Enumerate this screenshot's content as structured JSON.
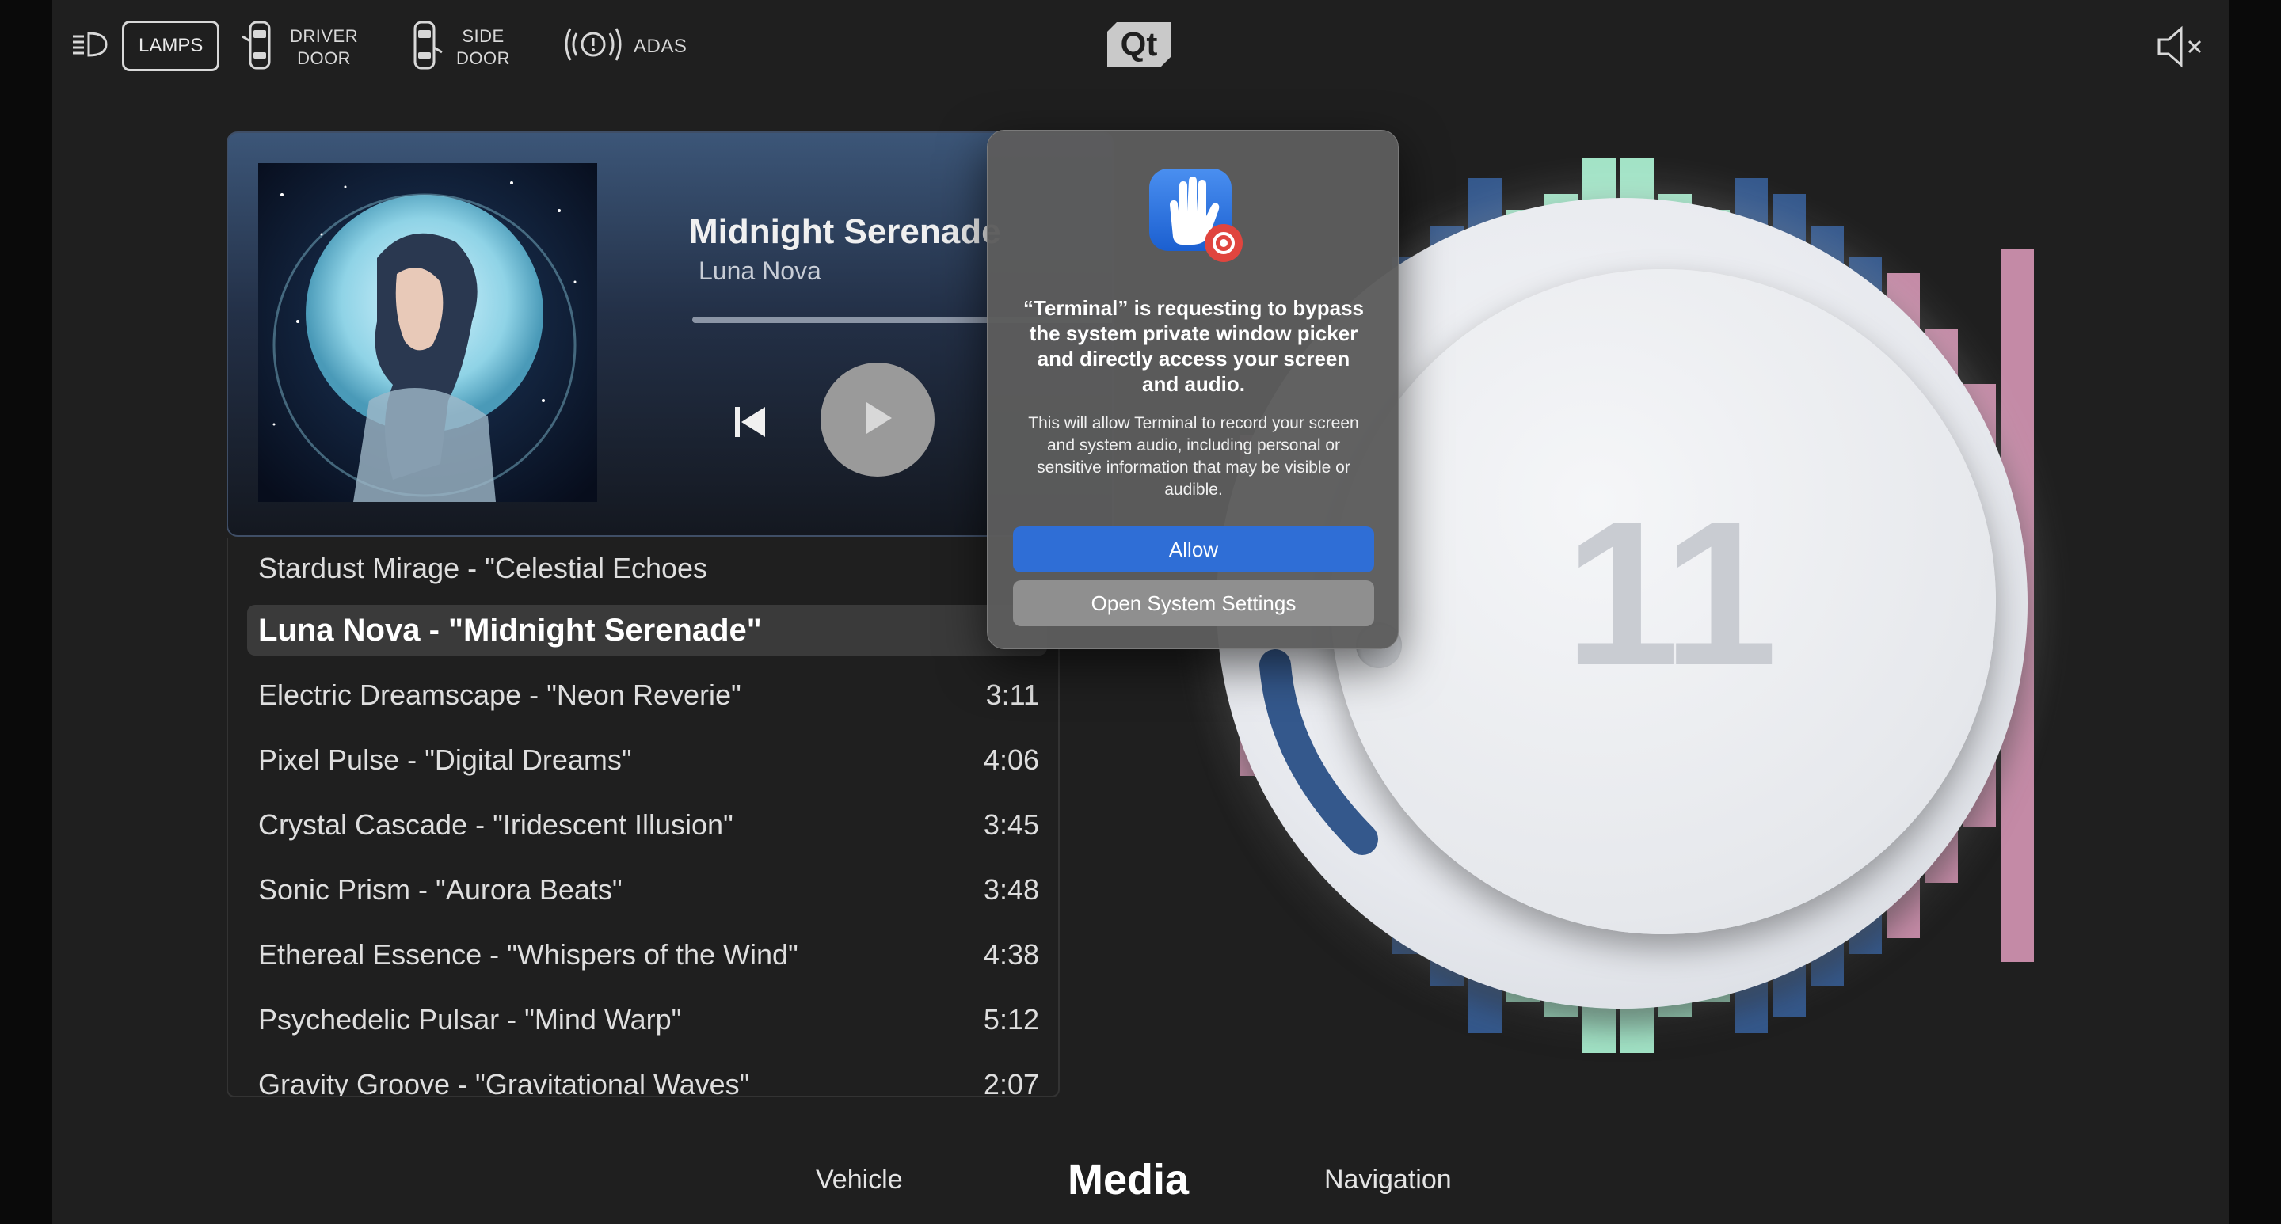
{
  "topbar": {
    "items": [
      {
        "label": "LAMPS",
        "icon": "headlamp-icon"
      },
      {
        "label1": "DRIVER",
        "label2": "DOOR",
        "icon": "car-driver-door-icon"
      },
      {
        "label1": "SIDE",
        "label2": "DOOR",
        "icon": "car-side-door-icon"
      },
      {
        "label": "ADAS",
        "icon": "adas-warning-icon"
      }
    ],
    "logo": "Qt",
    "mute_icon": "speaker-muted-icon"
  },
  "player": {
    "title": "Midnight Serenade",
    "artist": "Luna Nova",
    "progress_fraction": 0.0
  },
  "playlist": [
    {
      "track": "Stardust Mirage - \"Celestial Echoes",
      "duration": ""
    },
    {
      "track": "Luna Nova - \"Midnight Serenade\"",
      "duration": "",
      "active": true
    },
    {
      "track": "Electric Dreamscape - \"Neon Reverie\"",
      "duration": "3:11"
    },
    {
      "track": "Pixel Pulse - \"Digital Dreams\"",
      "duration": "4:06"
    },
    {
      "track": "Crystal Cascade - \"Iridescent Illusion\"",
      "duration": "3:45"
    },
    {
      "track": "Sonic Prism - \"Aurora Beats\"",
      "duration": "3:48"
    },
    {
      "track": "Ethereal Essence - \"Whispers of the Wind\"",
      "duration": "4:38"
    },
    {
      "track": "Psychedelic Pulsar - \"Mind Warp\"",
      "duration": "5:12"
    },
    {
      "track": "Gravity Groove - \"Gravitational Waves\"",
      "duration": "2:07"
    }
  ],
  "volume": {
    "value": "11",
    "colors": {
      "pink": "#c48aa6",
      "blue": "#34588c",
      "mint": "#a2e3c6"
    }
  },
  "dialog": {
    "title": "“Terminal” is requesting to bypass the system private window picker and directly access your screen and audio.",
    "body": "This will allow Terminal to record your screen and system audio, including personal or sensitive information that may be visible or audible.",
    "allow_label": "Allow",
    "settings_label": "Open System Settings",
    "icon": "screen-recording-hand-icon"
  },
  "bottom_nav": {
    "vehicle": "Vehicle",
    "media": "Media",
    "navigation": "Navigation",
    "active": "Media"
  }
}
